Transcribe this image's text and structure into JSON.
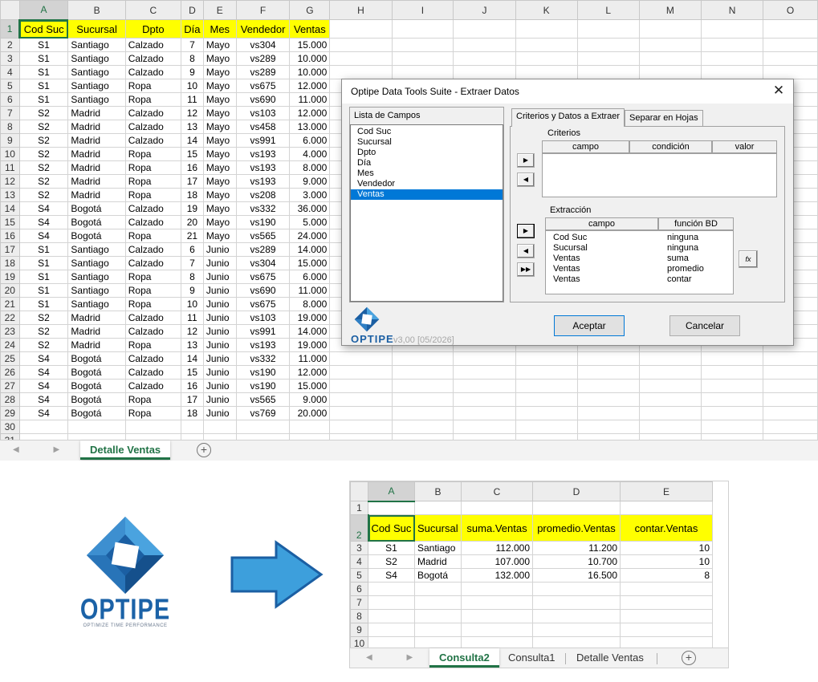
{
  "sheet1": {
    "columns": [
      "A",
      "B",
      "C",
      "D",
      "E",
      "F",
      "G",
      "H",
      "I",
      "J",
      "K",
      "L",
      "M",
      "N",
      "O"
    ],
    "headers": [
      "Cod Suc",
      "Sucursal",
      "Dpto",
      "Día",
      "Mes",
      "Vendedor",
      "Ventas"
    ],
    "rows": [
      [
        "S1",
        "Santiago",
        "Calzado",
        "7",
        "Mayo",
        "vs304",
        "15.000"
      ],
      [
        "S1",
        "Santiago",
        "Calzado",
        "8",
        "Mayo",
        "vs289",
        "10.000"
      ],
      [
        "S1",
        "Santiago",
        "Calzado",
        "9",
        "Mayo",
        "vs289",
        "10.000"
      ],
      [
        "S1",
        "Santiago",
        "Ropa",
        "10",
        "Mayo",
        "vs675",
        "12.000"
      ],
      [
        "S1",
        "Santiago",
        "Ropa",
        "11",
        "Mayo",
        "vs690",
        "11.000"
      ],
      [
        "S2",
        "Madrid",
        "Calzado",
        "12",
        "Mayo",
        "vs103",
        "12.000"
      ],
      [
        "S2",
        "Madrid",
        "Calzado",
        "13",
        "Mayo",
        "vs458",
        "13.000"
      ],
      [
        "S2",
        "Madrid",
        "Calzado",
        "14",
        "Mayo",
        "vs991",
        "6.000"
      ],
      [
        "S2",
        "Madrid",
        "Ropa",
        "15",
        "Mayo",
        "vs193",
        "4.000"
      ],
      [
        "S2",
        "Madrid",
        "Ropa",
        "16",
        "Mayo",
        "vs193",
        "8.000"
      ],
      [
        "S2",
        "Madrid",
        "Ropa",
        "17",
        "Mayo",
        "vs193",
        "9.000"
      ],
      [
        "S2",
        "Madrid",
        "Ropa",
        "18",
        "Mayo",
        "vs208",
        "3.000"
      ],
      [
        "S4",
        "Bogotá",
        "Calzado",
        "19",
        "Mayo",
        "vs332",
        "36.000"
      ],
      [
        "S4",
        "Bogotá",
        "Calzado",
        "20",
        "Mayo",
        "vs190",
        "5.000"
      ],
      [
        "S4",
        "Bogotá",
        "Ropa",
        "21",
        "Mayo",
        "vs565",
        "24.000"
      ],
      [
        "S1",
        "Santiago",
        "Calzado",
        "6",
        "Junio",
        "vs289",
        "14.000"
      ],
      [
        "S1",
        "Santiago",
        "Calzado",
        "7",
        "Junio",
        "vs304",
        "15.000"
      ],
      [
        "S1",
        "Santiago",
        "Ropa",
        "8",
        "Junio",
        "vs675",
        "6.000"
      ],
      [
        "S1",
        "Santiago",
        "Ropa",
        "9",
        "Junio",
        "vs690",
        "11.000"
      ],
      [
        "S1",
        "Santiago",
        "Ropa",
        "10",
        "Junio",
        "vs675",
        "8.000"
      ],
      [
        "S2",
        "Madrid",
        "Calzado",
        "11",
        "Junio",
        "vs103",
        "19.000"
      ],
      [
        "S2",
        "Madrid",
        "Calzado",
        "12",
        "Junio",
        "vs991",
        "14.000"
      ],
      [
        "S2",
        "Madrid",
        "Ropa",
        "13",
        "Junio",
        "vs193",
        "19.000"
      ],
      [
        "S4",
        "Bogotá",
        "Calzado",
        "14",
        "Junio",
        "vs332",
        "11.000"
      ],
      [
        "S4",
        "Bogotá",
        "Calzado",
        "15",
        "Junio",
        "vs190",
        "12.000"
      ],
      [
        "S4",
        "Bogotá",
        "Calzado",
        "16",
        "Junio",
        "vs190",
        "15.000"
      ],
      [
        "S4",
        "Bogotá",
        "Ropa",
        "17",
        "Junio",
        "vs565",
        "9.000"
      ],
      [
        "S4",
        "Bogotá",
        "Ropa",
        "18",
        "Junio",
        "vs769",
        "20.000"
      ]
    ],
    "extra_rows": [
      "30",
      "31"
    ],
    "tabs": {
      "active": "Detalle Ventas",
      "add": "+"
    }
  },
  "dialog": {
    "title": "Optipe Data Tools Suite - Extraer Datos",
    "close": "✕",
    "fields_label": "Lista de Campos",
    "fields": [
      "Cod Suc",
      "Sucursal",
      "Dpto",
      "Día",
      "Mes",
      "Vendedor",
      "Ventas"
    ],
    "selected_field_index": 6,
    "tabs": [
      "Criterios y Datos a Extraer",
      "Separar en Hojas"
    ],
    "criteria_label": "Criterios",
    "criteria_columns": [
      "campo",
      "condición",
      "valor"
    ],
    "extraction_label": "Extracción",
    "extraction_columns": [
      "campo",
      "función BD"
    ],
    "extraction_rows": [
      [
        "Cod Suc",
        "ninguna"
      ],
      [
        "Sucursal",
        "ninguna"
      ],
      [
        "Ventas",
        "suma"
      ],
      [
        "Ventas",
        "promedio"
      ],
      [
        "Ventas",
        "contar"
      ]
    ],
    "fx_label": "fx",
    "accept_label": "Aceptar",
    "cancel_label": "Cancelar",
    "logo_text": "OPTIPE",
    "version": "v3,00 [05/2026]"
  },
  "logo": {
    "name": "OPTIPE",
    "tagline": "OPTIMIZE TIME PERFORMANCE",
    "colors": {
      "dark": "#1b5fa3",
      "light": "#4aa3df"
    }
  },
  "arrow_color": "#3d9fdc",
  "sheet2": {
    "columns": [
      "A",
      "B",
      "C",
      "D",
      "E"
    ],
    "headers": [
      "Cod Suc",
      "Sucursal",
      "suma.Ventas",
      "promedio.Ventas",
      "contar.Ventas"
    ],
    "rows": [
      [
        "S1",
        "Santiago",
        "112.000",
        "11.200",
        "10"
      ],
      [
        "S2",
        "Madrid",
        "107.000",
        "10.700",
        "10"
      ],
      [
        "S4",
        "Bogotá",
        "132.000",
        "16.500",
        "8"
      ]
    ],
    "empty_rows": [
      "6",
      "7",
      "8",
      "9",
      "10"
    ],
    "tabs": [
      "Consulta2",
      "Consulta1",
      "Detalle Ventas"
    ],
    "add": "+"
  }
}
